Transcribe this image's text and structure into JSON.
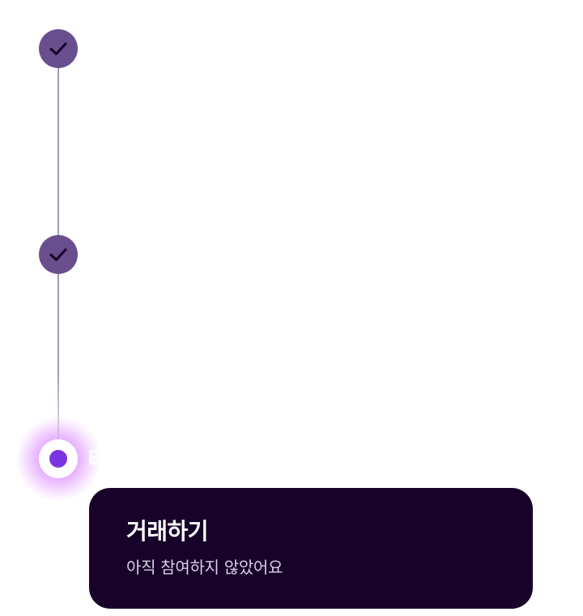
{
  "steps": [
    {
      "status": "completed",
      "icon": "check-icon"
    },
    {
      "status": "completed",
      "icon": "check-icon"
    },
    {
      "status": "current",
      "icon": "current-dot-icon",
      "label": "B"
    }
  ],
  "current_step_card": {
    "title": "거래하기",
    "subtitle": "아직 참여하지 않았어요"
  },
  "colors": {
    "completed_step": "#6a4f8f",
    "connector": "#a79bb7",
    "current_dot": "#7b35e0",
    "current_glow": "#d678ff",
    "card_background": "#180229",
    "card_title": "#ffffff",
    "card_subtitle": "#d8cfe6"
  }
}
